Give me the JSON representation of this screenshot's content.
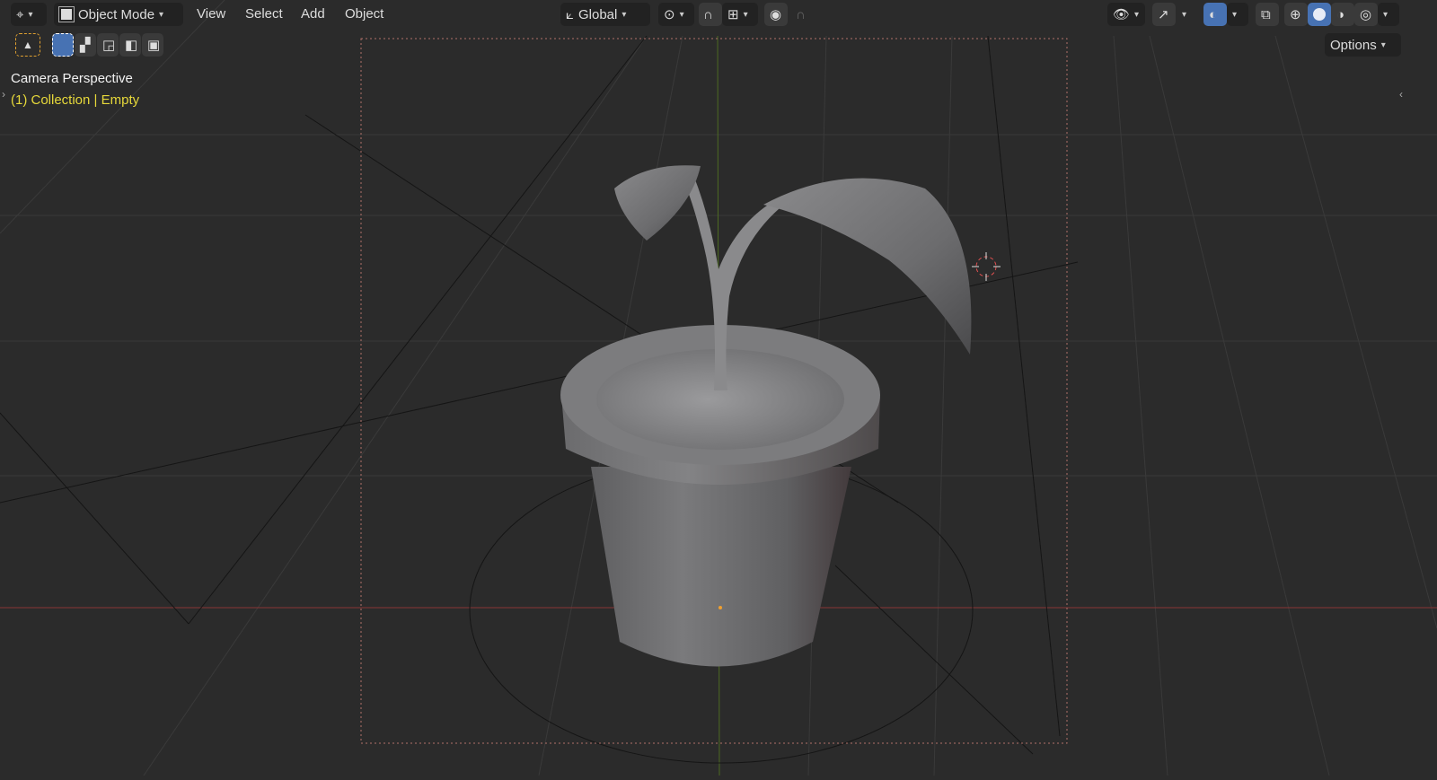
{
  "header": {
    "editor_type_icon": "viewport-editor-icon",
    "mode": "Object Mode",
    "menus": [
      "View",
      "Select",
      "Add",
      "Object"
    ],
    "transform_orientation": "Global",
    "options_label": "Options"
  },
  "overlay": {
    "view_name": "Camera Perspective",
    "collection_info": "(1) Collection | Empty"
  },
  "colors": {
    "background": "#2b2b2b",
    "accent": "#4772b3",
    "info_text": "#e6d83a",
    "x_axis": "#9b3a3a",
    "y_axis": "#5b7a2a"
  }
}
